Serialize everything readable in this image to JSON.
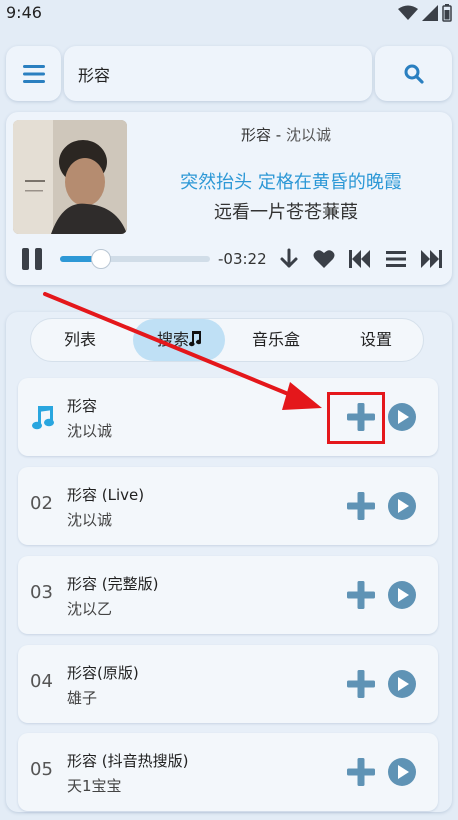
{
  "status": {
    "time": "9:46"
  },
  "search": {
    "query": "形容"
  },
  "player": {
    "title": "形容",
    "separator": " - ",
    "artist": "沈以诚",
    "lyric_current": "突然抬头 定格在黄昏的晚霞",
    "lyric_next": "远看一片苍苍蒹葭",
    "remaining": "-03:22",
    "progress": 0.27,
    "accent": "#2d98d6"
  },
  "tabs": [
    {
      "label": "列表"
    },
    {
      "label": "搜索",
      "icon": "music-note-icon"
    },
    {
      "label": "音乐盒"
    },
    {
      "label": "设置"
    }
  ],
  "results": [
    {
      "index": "",
      "icon": "music-note-icon",
      "title": "形容",
      "artist": "沈以诚"
    },
    {
      "index": "02",
      "title": "形容 (Live)",
      "artist": "沈以诚"
    },
    {
      "index": "03",
      "title": "形容 (完整版)",
      "artist": "沈以乙"
    },
    {
      "index": "04",
      "title": "形容(原版)",
      "artist": "雄子"
    },
    {
      "index": "05",
      "title": "形容 (抖音热搜版)",
      "artist": "天1宝宝"
    }
  ],
  "colors": {
    "annotation": "#e4171b",
    "row_button": "#5f93b5"
  }
}
